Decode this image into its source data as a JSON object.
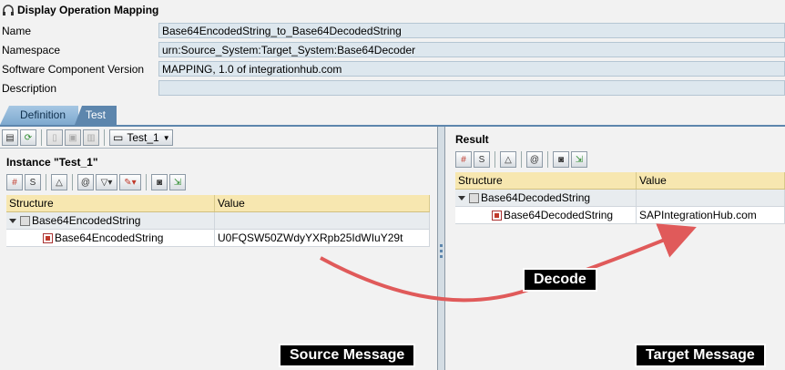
{
  "header": {
    "title": "Display Operation Mapping"
  },
  "fields": [
    {
      "label": "Name",
      "value": "Base64EncodedString_to_Base64DecodedString"
    },
    {
      "label": "Namespace",
      "value": "urn:Source_System:Target_System:Base64Decoder"
    },
    {
      "label": "Software Component Version",
      "value": "MAPPING, 1.0 of integrationhub.com"
    },
    {
      "label": "Description",
      "value": ""
    }
  ],
  "tabs": [
    {
      "label": "Definition",
      "active": false
    },
    {
      "label": "Test",
      "active": true
    }
  ],
  "left_pane": {
    "instance_selector": "Test_1",
    "instance_title": "Instance \"Test_1\"",
    "columns": [
      "Structure",
      "Value"
    ],
    "rows": [
      {
        "structure": "Base64EncodedString",
        "value": ""
      },
      {
        "structure": "Base64EncodedString",
        "value": "U0FQSW50ZWdyYXRpb25IdWIuY29t"
      }
    ]
  },
  "right_pane": {
    "title": "Result",
    "columns": [
      "Structure",
      "Value"
    ],
    "rows": [
      {
        "structure": "Base64DecodedString",
        "value": ""
      },
      {
        "structure": "Base64DecodedString",
        "value": "SAPIntegrationHub.com"
      }
    ]
  },
  "annotations": {
    "decode": "Decode",
    "source": "Source Message",
    "target": "Target Message",
    "arrow_color": "#e05a5a"
  },
  "colors": {
    "tab_active": "#5d86ad",
    "header_row": "#f7e7b0",
    "field_bg": "#dde7ee"
  },
  "icons": [
    "headphones-icon",
    "toggle-display-icon",
    "execute-icon",
    "new-icon",
    "save-icon",
    "delete-icon",
    "instance-icon",
    "table-icon",
    "source-view-icon",
    "collapse-icon",
    "clear-icon",
    "filter-icon",
    "edit-icon",
    "binoculars-icon",
    "export-icon"
  ]
}
